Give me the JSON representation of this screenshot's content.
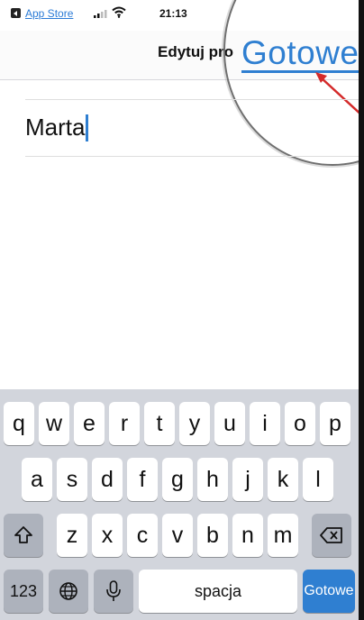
{
  "statusbar": {
    "app_back_label": "App Store",
    "time": "21:13"
  },
  "navbar": {
    "title": "Edytuj pro",
    "done_label": "Gotowe"
  },
  "form": {
    "name_value": "Marta"
  },
  "keyboard": {
    "row1": [
      "q",
      "w",
      "e",
      "r",
      "t",
      "y",
      "u",
      "i",
      "o",
      "p"
    ],
    "row2": [
      "a",
      "s",
      "d",
      "f",
      "g",
      "h",
      "j",
      "k",
      "l"
    ],
    "row3": [
      "z",
      "x",
      "c",
      "v",
      "b",
      "n",
      "m"
    ],
    "numbers_label": "123",
    "space_label": "spacja",
    "return_label": "Gotowe"
  },
  "colors": {
    "accent": "#2f7fd1",
    "arrow": "#d42a2a",
    "keyboard_bg": "#d2d5dc"
  },
  "icons": {
    "back": "app-store-back-icon",
    "signal": "signal-icon",
    "wifi": "wifi-icon",
    "shift": "shift-icon",
    "delete": "backspace-icon",
    "globe": "globe-icon",
    "mic": "microphone-icon"
  }
}
